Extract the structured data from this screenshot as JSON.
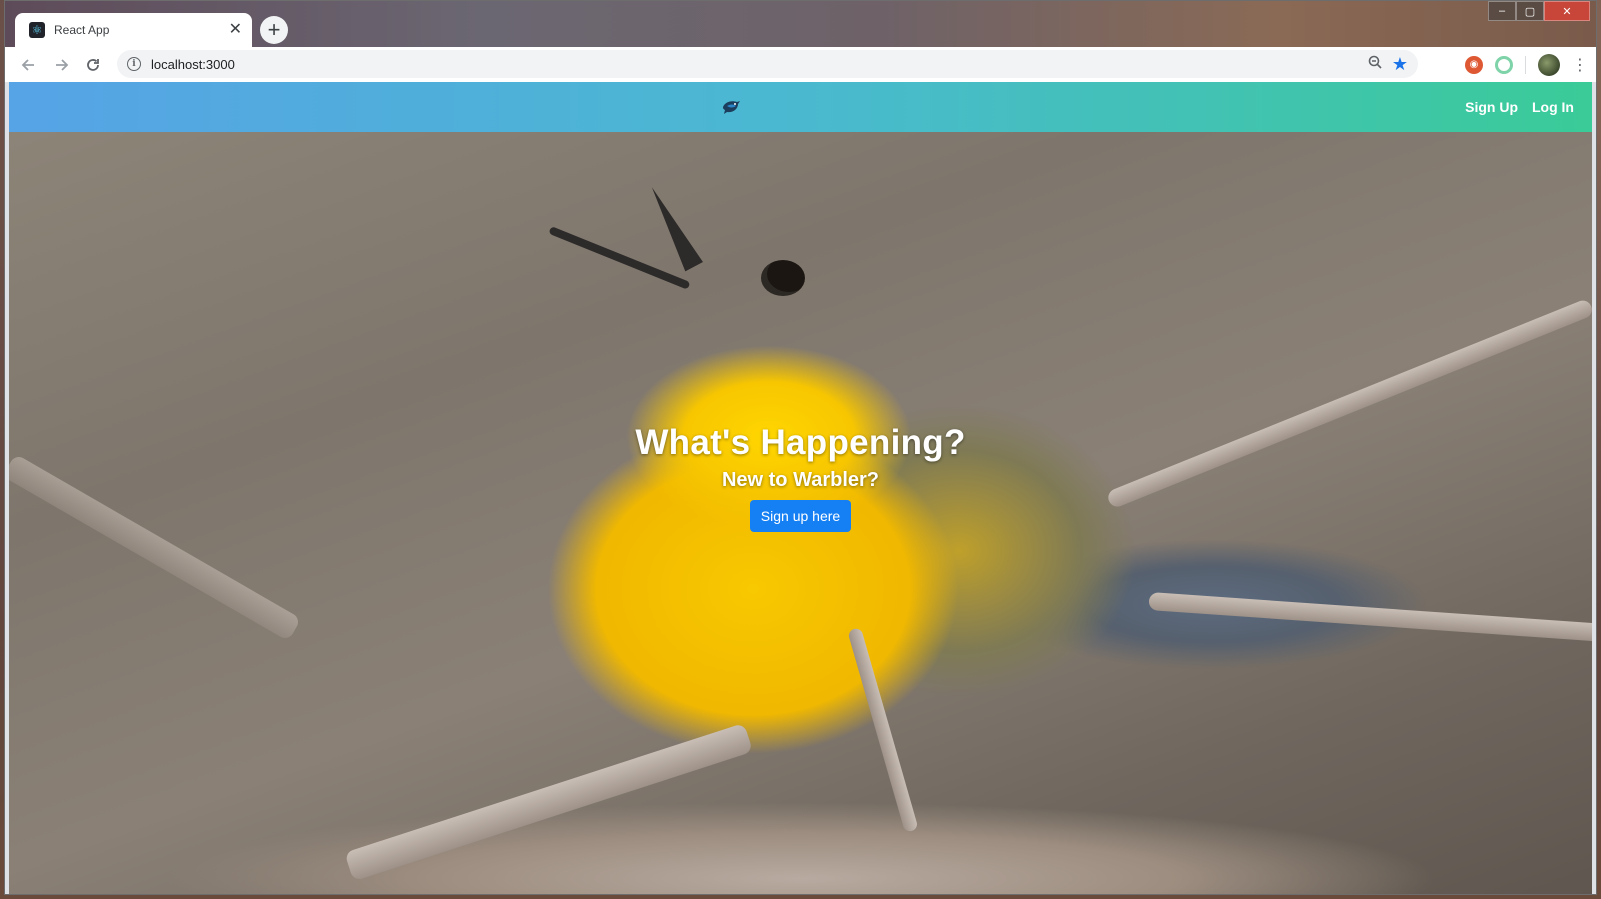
{
  "browser": {
    "tab_title": "React App",
    "tab_close": "✕",
    "new_tab": "+",
    "url": "localhost:3000",
    "back_icon": "arrow-left-icon",
    "forward_icon": "arrow-right-icon",
    "reload_icon": "reload-icon",
    "window_controls": [
      "minimize",
      "maximize",
      "close"
    ]
  },
  "navbar": {
    "brand_icon": "warbler-bird-icon",
    "links": [
      {
        "label": "Sign Up"
      },
      {
        "label": "Log In"
      }
    ],
    "gradient_start": "#56a3e6",
    "gradient_end": "#3acb98"
  },
  "hero": {
    "title": "What's Happening?",
    "subtitle": "New to Warbler?",
    "button_label": "Sign up here",
    "button_color": "#1580f4"
  }
}
